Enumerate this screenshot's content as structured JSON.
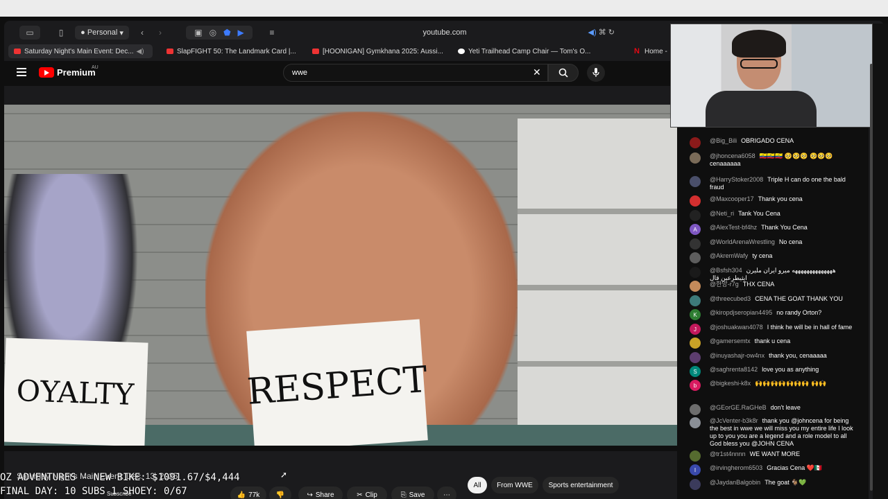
{
  "menubar": {
    "apple_glyph": ""
  },
  "browser": {
    "profile_label": "Personal",
    "url": "youtube.com",
    "tabs": [
      {
        "title": "Saturday Night's Main Event: Dec...",
        "favicon": "youtube"
      },
      {
        "title": "SlapFIGHT 50: The Landmark Card |...",
        "favicon": "youtube"
      },
      {
        "title": "[HOONIGAN] Gymkhana 2025: Aussi...",
        "favicon": "youtube"
      },
      {
        "title": "Yeti Trailhead Camp Chair — Tom's O...",
        "favicon": "circle"
      },
      {
        "title": "Home -",
        "favicon": "netflix"
      }
    ]
  },
  "youtube": {
    "brand": "Premium",
    "region": "AU",
    "search_value": "wwe",
    "video": {
      "sign_left": "OYALTY",
      "sign_right": "RESPECT",
      "title": "Saturday Night's Main Event: Dec. 13, 2025"
    },
    "actions": {
      "likes": "77k",
      "share": "Share",
      "clip": "Clip",
      "save": "Save",
      "subscribe": "Subscribe"
    },
    "chips": [
      "All",
      "From WWE",
      "Sports entertainment"
    ]
  },
  "stream_overlay": {
    "line1": "OZ ADVENTURES - NEW BIKE: $1091.67/$4,444",
    "line2": "FINAL DAY: 10 SUBS 1 SHOEY: 0/67"
  },
  "colors": {
    "accent": "#ff0000",
    "chat_author": "#aaaaaa",
    "heart": "#e53935",
    "highfive": "#f06292"
  },
  "chat": [
    {
      "author": "@Big_Bili",
      "text": "OBRIGADO CENA",
      "avatar": "icon",
      "avatar_color": "#8b1a1a"
    },
    {
      "author": "@jhoncena6058",
      "text": "🇪🇨🇪🇨🇪🇨 🥺🥺🥺 🥺🥺🥺 cenaaaaaa",
      "avatar": "photo",
      "avatar_color": "#7a6b58"
    },
    {
      "author": "@HarryStoker2008",
      "text": "Triple H can do one the bald fraud",
      "avatar": "photo",
      "avatar_color": "#4a4f6a"
    },
    {
      "author": "@Maxcooper17",
      "text": "Thank you cena",
      "avatar": "icon",
      "avatar_color": "#d32f2f"
    },
    {
      "author": "@Neti_ri",
      "text": "Tank You Cena",
      "avatar": "icon",
      "avatar_color": "#222222"
    },
    {
      "author": "@AlexTest-bf4hz",
      "text": "Thank You Cena",
      "avatar": "A",
      "avatar_color": "#7e57c2"
    },
    {
      "author": "@WorldArenaWrestling",
      "text": "No cena",
      "avatar": "icon",
      "avatar_color": "#333333"
    },
    {
      "author": "@AkremWafy",
      "text": "ty cena",
      "avatar": "photo",
      "avatar_color": "#5d5d5d"
    },
    {
      "author": "@Bsfsh304",
      "text": "ههههههههههههههه ميرو ايران مليرن ايثيطرعين قال",
      "avatar": "photo",
      "avatar_color": "#1a1a1a"
    },
    {
      "author": "@한앙-r7g",
      "text": "THX CENA",
      "avatar": "photo",
      "avatar_color": "#c48a5a"
    },
    {
      "author": "@threecubed3",
      "text": "CENA THE GOAT THANK YOU",
      "avatar": "photo",
      "avatar_color": "#3d7a7a"
    },
    {
      "author": "@kiropdjseropian4495",
      "text": "no randy Orton?",
      "avatar": "K",
      "avatar_color": "#2e7d32"
    },
    {
      "author": "@joshuakwan4078",
      "text": "I think he will be in hall of fame",
      "avatar": "J",
      "avatar_color": "#c2185b"
    },
    {
      "author": "@gamersemtx",
      "text": "thank u cena",
      "avatar": "photo",
      "avatar_color": "#c9a227"
    },
    {
      "author": "@inuyashajr-ow4nx",
      "text": "thank you, cenaaaaa",
      "avatar": "photo",
      "avatar_color": "#5c3d6e"
    },
    {
      "author": "@saghrenta8142",
      "text": "love you as anything",
      "avatar": "S",
      "avatar_color": "#00897b"
    },
    {
      "author": "@bigkeshi-k8x",
      "text": "🙌🙌🙌🙌🙌🙌🙌 🙌🙌",
      "avatar": "b",
      "avatar_color": "#d81b60"
    },
    {
      "author": "@GEorGE.RaGHeB",
      "text": "don't leave",
      "avatar": "photo",
      "avatar_color": "#6d6d6d"
    },
    {
      "author": "@JcVenter-b3k8r",
      "text": "thank you @johncena for being the best in wwe we will miss you my entire life I look up to you you are a legend and a role model to all God bless you @JOHN CENA",
      "avatar": "photo",
      "avatar_color": "#8a8f96"
    },
    {
      "author": "@tr1st4nnnn",
      "text": "WE WANT MORE",
      "avatar": "photo",
      "avatar_color": "#556b2f"
    },
    {
      "author": "@irvingherom6503",
      "text": "Gracias Cena ❤️🇲🇽",
      "avatar": "I",
      "avatar_color": "#3949ab"
    },
    {
      "author": "@JaydanBalgobin",
      "text": "The goat 🐐💚",
      "avatar": "photo",
      "avatar_color": "#3b3b5c"
    }
  ]
}
